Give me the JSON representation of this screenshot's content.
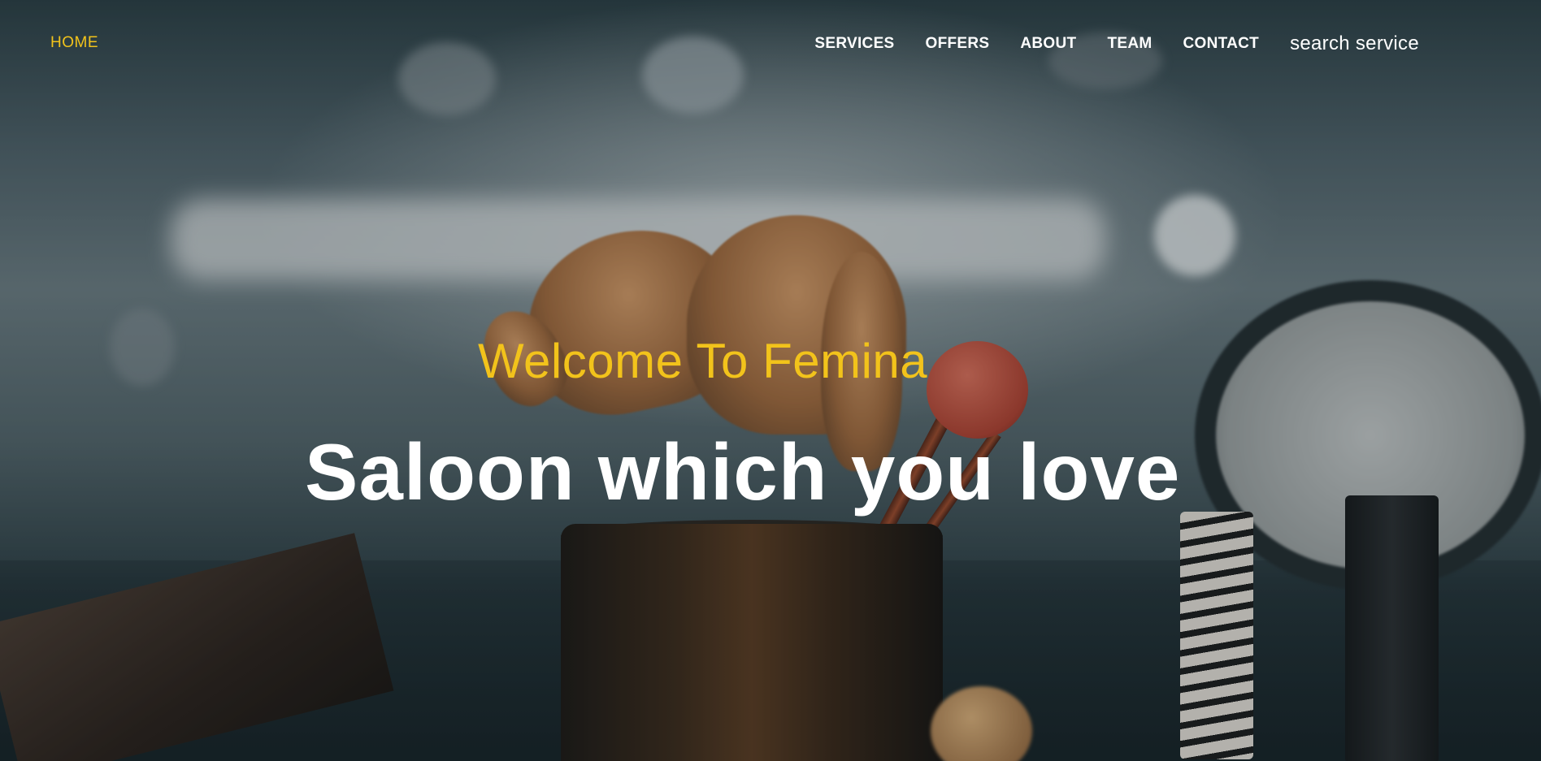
{
  "nav": {
    "home": "HOME",
    "links": [
      "SERVICES",
      "OFFERS",
      "ABOUT",
      "TEAM",
      "CONTACT"
    ],
    "search": "search service"
  },
  "hero": {
    "welcome": "Welcome To Femina",
    "headline": "Saloon which you love"
  },
  "colors": {
    "accent": "#f2c31b",
    "text": "#ffffff",
    "background": "#1e3036"
  }
}
